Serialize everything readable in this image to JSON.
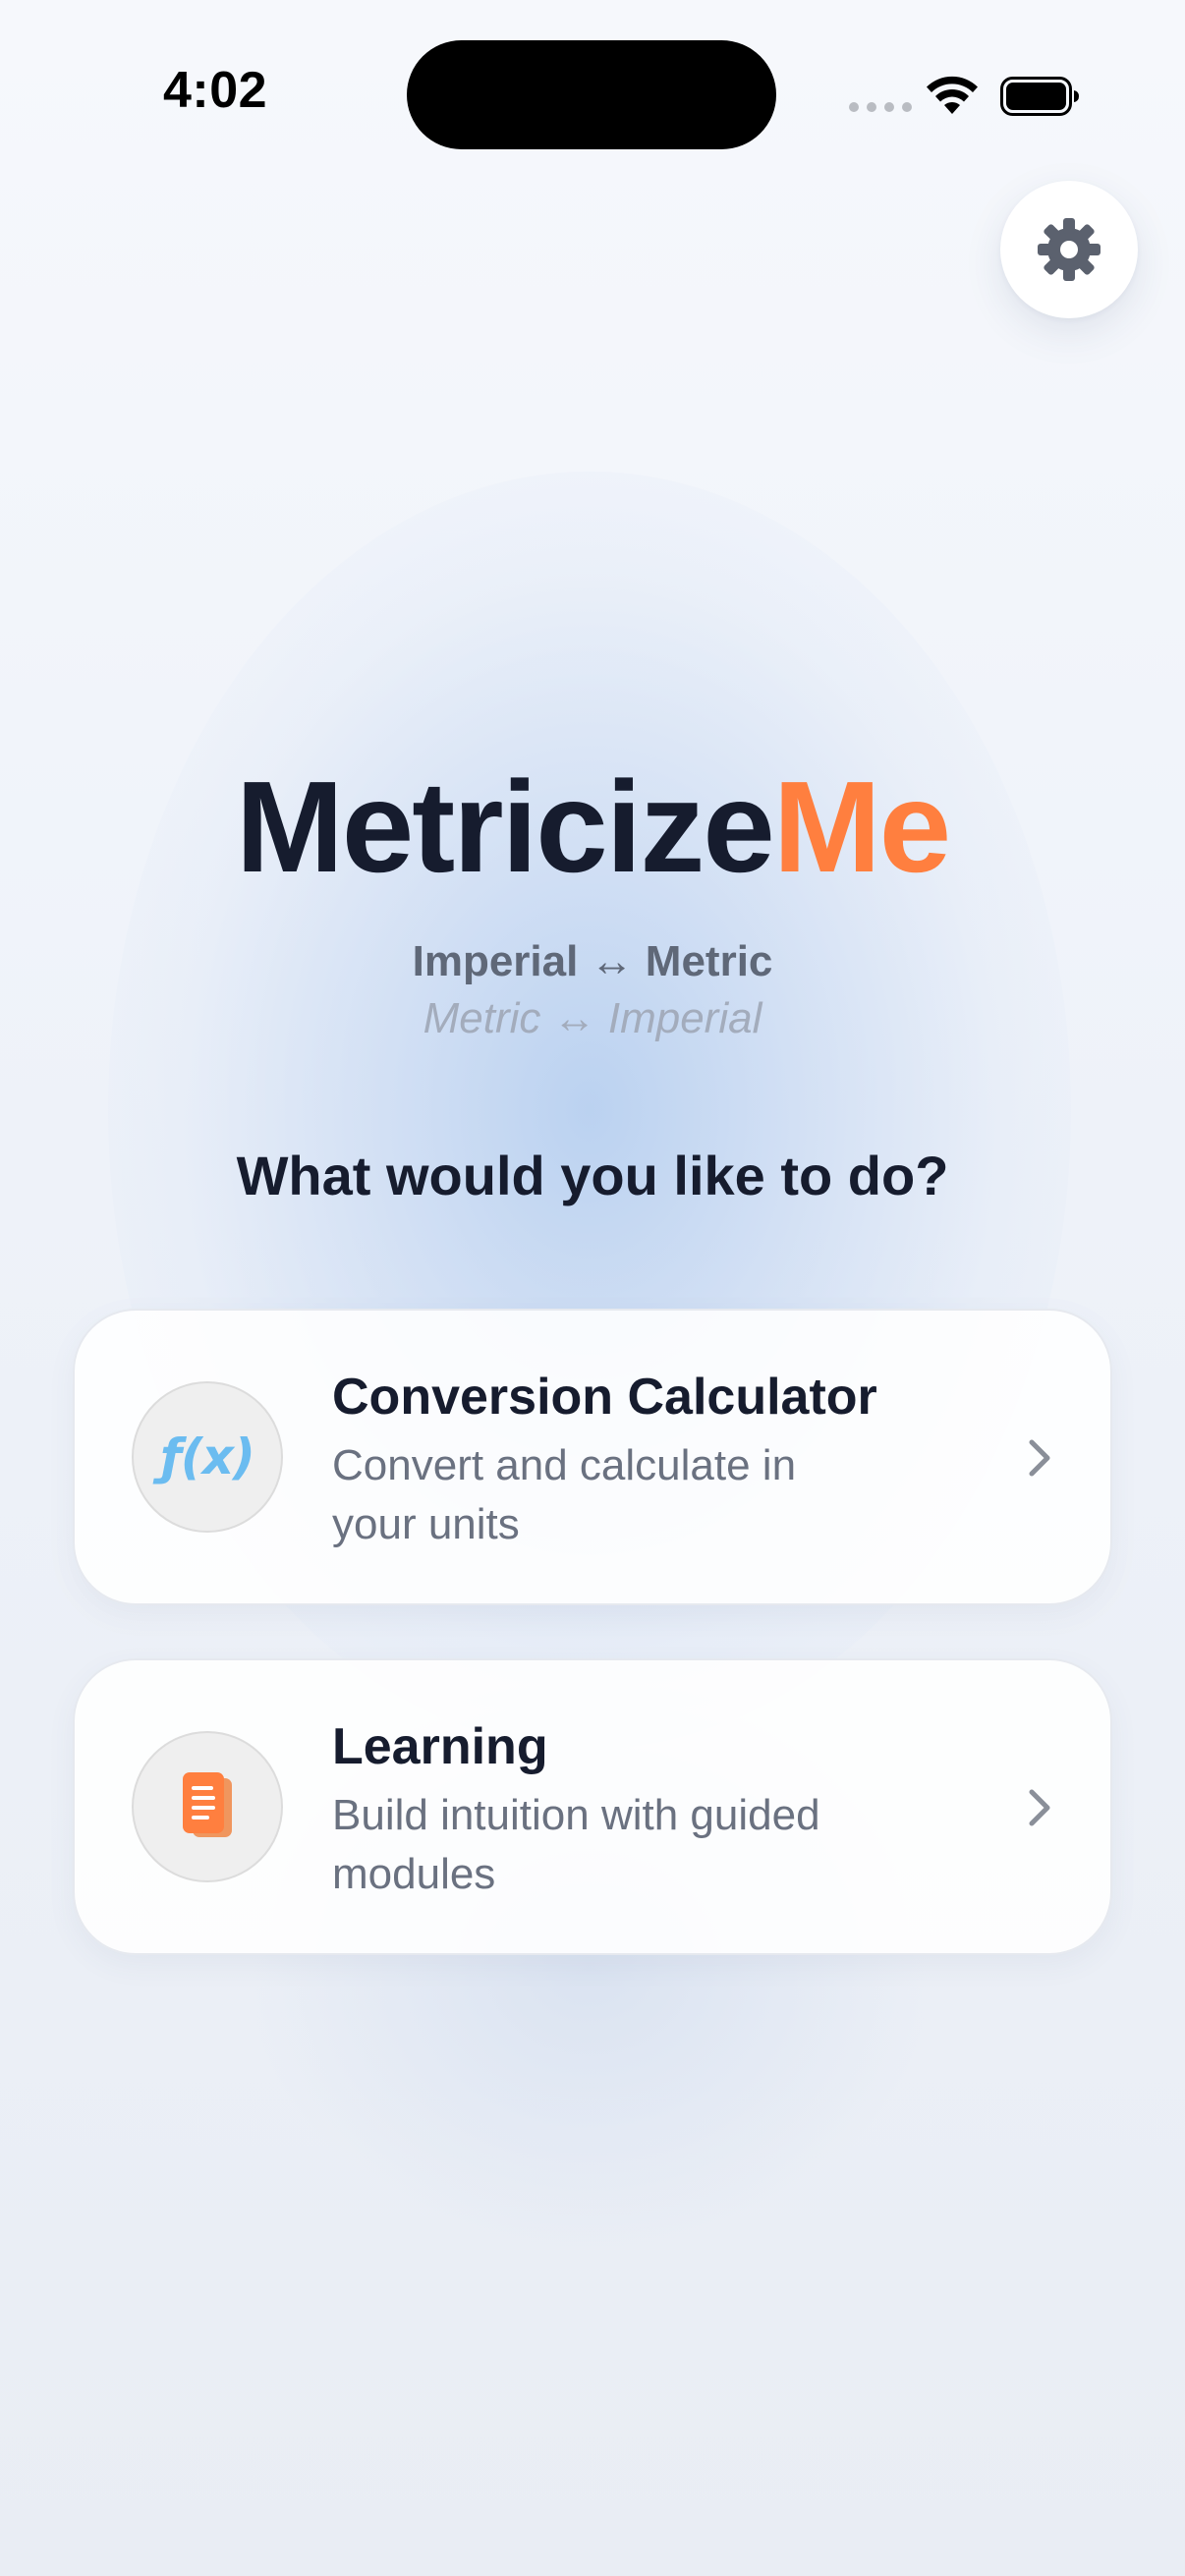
{
  "status_bar": {
    "time": "4:02"
  },
  "settings": {
    "icon": "gear-icon"
  },
  "app": {
    "title_main": "Metricize",
    "title_accent": "Me",
    "accent_color": "#ff7f3f",
    "subtitle_primary": "Imperial ↔ Metric",
    "subtitle_secondary": "Metric ↔ Imperial"
  },
  "prompt": "What would you like to do?",
  "cards": [
    {
      "title": "Conversion Calculator",
      "description": "Convert and calculate in your units",
      "icon": "function-icon",
      "icon_text": "ƒ(x)",
      "icon_color": "#6bbcf0"
    },
    {
      "title": "Learning",
      "description": "Build intuition with guided modules",
      "icon": "book-icon",
      "icon_color": "#ff7f3f"
    }
  ]
}
